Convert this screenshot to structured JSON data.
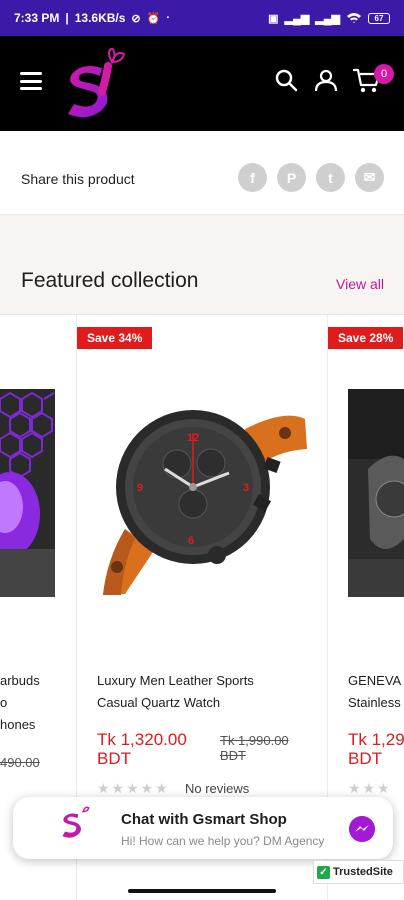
{
  "status_bar": {
    "time": "7:33 PM",
    "network_speed": "13.6KB/s",
    "battery": "67",
    "icons": [
      "mute-icon",
      "alarm-icon",
      "sim-icon",
      "signal-icon",
      "wifi-icon"
    ]
  },
  "header": {
    "logo_letter": "S",
    "cart_count": "0",
    "icons": [
      "menu-icon",
      "search-icon",
      "account-icon",
      "cart-icon"
    ]
  },
  "share": {
    "label": "Share this product",
    "icons": [
      {
        "name": "facebook-icon",
        "glyph": "f"
      },
      {
        "name": "pinterest-icon",
        "glyph": "P"
      },
      {
        "name": "twitter-icon",
        "glyph": "t"
      },
      {
        "name": "email-icon",
        "glyph": "✉"
      }
    ]
  },
  "featured": {
    "title": "Featured collection",
    "view_all": "View all"
  },
  "products": [
    {
      "title_lines": [
        "arbuds",
        "o",
        "hones"
      ],
      "old_price": "490.00"
    },
    {
      "badge": "Save 34%",
      "title_lines": [
        "Luxury Men Leather Sports",
        "Casual Quartz Watch"
      ],
      "price_lines": [
        "Tk 1,320.00",
        "BDT"
      ],
      "old_price_lines": [
        "Tk 1,990.00",
        "BDT"
      ],
      "rating_stars": "★★★★★",
      "reviews": "No reviews"
    },
    {
      "badge": "Save 28%",
      "title_lines": [
        "GENEVA",
        "Stainless"
      ],
      "price_lines": [
        "Tk 1,29",
        "BDT"
      ],
      "rating_stars": "★★★"
    }
  ],
  "chat": {
    "title": "Chat with Gsmart Shop",
    "subtitle": "Hi! How can we help you? DM Agency"
  },
  "trusted_site": "TrustedSite",
  "colors": {
    "status_bar": "#3b1aa8",
    "header": "#000000",
    "accent": "#c0179a",
    "sale": "#e01b1b",
    "badge": "#d61aa8"
  }
}
